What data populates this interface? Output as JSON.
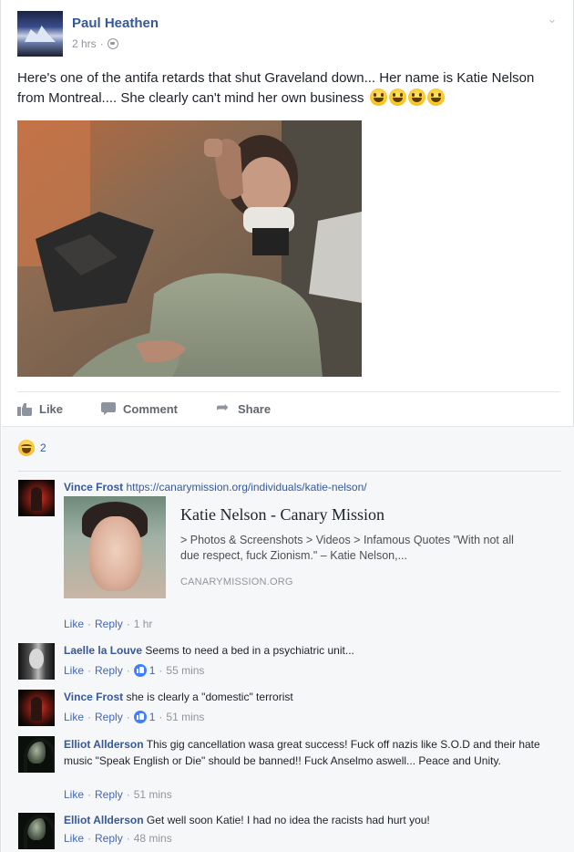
{
  "post": {
    "author": "Paul Heathen",
    "timestamp": "2 hrs",
    "separator": "·",
    "text": "Here's one of the antifa retards that shut Graveland down... Her name is Katie Nelson from Montreal.... She clearly can't mind her own business",
    "emoji_count": 4
  },
  "actions": {
    "like": "Like",
    "comment": "Comment",
    "share": "Share"
  },
  "reactions": {
    "count": "2"
  },
  "comments": [
    {
      "name": "Vince Frost",
      "text": "https://canarymission.org/individuals/katie-nelson/",
      "is_link": true,
      "preview": {
        "title": "Katie Nelson - Canary Mission",
        "description": "> Photos & Screenshots > Videos > Infamous Quotes \"With not all due respect, fuck Zionism.\" – Katie Nelson,...",
        "domain": "CANARYMISSION.ORG"
      },
      "like": "Like",
      "reply": "Reply",
      "likes": "",
      "time": "1 hr"
    },
    {
      "name": "Laelle la Louve",
      "text": "Seems to need a bed in a psychiatric unit...",
      "like": "Like",
      "reply": "Reply",
      "likes": "1",
      "time": "55 mins"
    },
    {
      "name": "Vince Frost",
      "text": "she is clearly a \"domestic\" terrorist",
      "like": "Like",
      "reply": "Reply",
      "likes": "1",
      "time": "51 mins"
    },
    {
      "name": "Elliot Allderson",
      "text": "This gig cancellation wasa great success! Fuck off nazis like S.O.D and their hate music \"Speak English or Die\" should be banned!! Fuck Anselmo aswell... Peace and Unity.",
      "like": "Like",
      "reply": "Reply",
      "likes": "",
      "time": "51 mins"
    },
    {
      "name": "Elliot Allderson",
      "text": "Get well soon Katie! I had no idea the racists had hurt you!",
      "like": "Like",
      "reply": "Reply",
      "likes": "",
      "time": "48 mins"
    }
  ],
  "colors": {
    "link": "#365899",
    "action_blue": "#4267b2",
    "muted": "#90949c",
    "comments_bg": "#f6f7f9"
  }
}
